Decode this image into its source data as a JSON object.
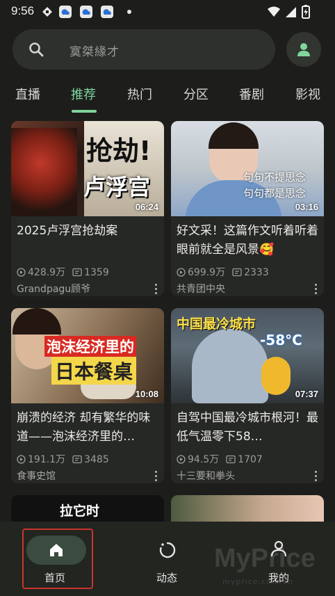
{
  "status_bar": {
    "time": "9:56"
  },
  "search": {
    "placeholder": "寞桀緣才"
  },
  "tabs": [
    {
      "label": "直播"
    },
    {
      "label": "推荐",
      "active": true
    },
    {
      "label": "热门"
    },
    {
      "label": "分区"
    },
    {
      "label": "番剧"
    },
    {
      "label": "影视"
    }
  ],
  "videos": [
    {
      "title": "2025卢浮宫抢劫案",
      "duration": "06:24",
      "views": "428.9万",
      "danmaku": "1359",
      "uploader": "Grandpagu顾爷",
      "thumb_text": [
        "抢劫!",
        "卢浮宫"
      ]
    },
    {
      "title": "好文采！这篇作文听着听着眼前就全是风景🥰",
      "duration": "03:16",
      "views": "699.9万",
      "danmaku": "2333",
      "uploader": "共青团中央",
      "thumb_text": [
        "句句不提思念",
        "句句都是思念"
      ]
    },
    {
      "title": "崩溃的经济 却有繁华的味道——泡沫经济里的…",
      "duration": "10:08",
      "views": "191.1万",
      "danmaku": "3485",
      "uploader": "食事史馆",
      "thumb_text": [
        "泡沫经济里的",
        "日本餐桌"
      ]
    },
    {
      "title": "自驾中国最冷城市根河！最低气温零下58…",
      "duration": "07:37",
      "views": "94.5万",
      "danmaku": "1707",
      "uploader": "十三要和拳头",
      "thumb_text": [
        "中国最冷城市",
        "-58°C"
      ]
    },
    {
      "thumb_text": [
        "拉它时"
      ]
    }
  ],
  "bottom_nav": [
    {
      "label": "首页",
      "icon": "home-icon",
      "active": true
    },
    {
      "label": "动态",
      "icon": "dynamic-icon"
    },
    {
      "label": "我的",
      "icon": "profile-icon"
    }
  ],
  "watermark": {
    "text": "MyPrice",
    "sub": "myprice.com.cn"
  },
  "colors": {
    "accent": "#7fd59c",
    "background": "#1d1e1c",
    "card": "#262825",
    "highlight": "#c9352b"
  }
}
